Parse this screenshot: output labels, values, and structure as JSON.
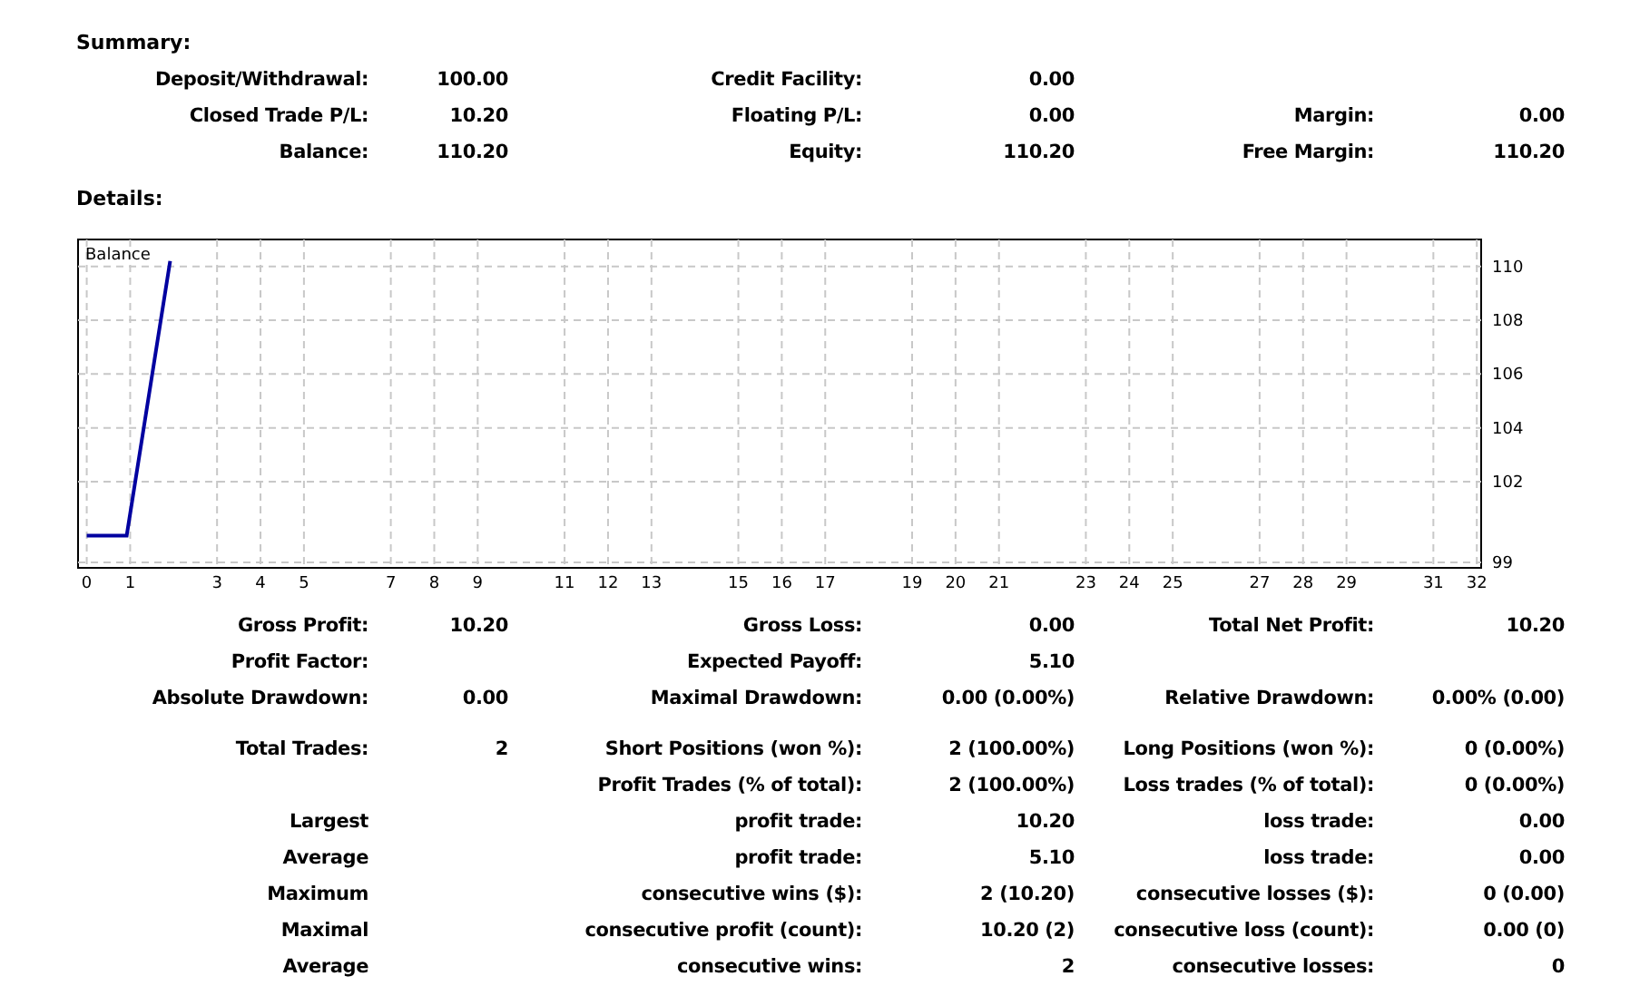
{
  "summary": {
    "title": "Summary:",
    "rows": [
      {
        "left": {
          "label": "Deposit/Withdrawal:",
          "value": "100.00"
        },
        "middle": {
          "label": "Credit Facility:",
          "value": "0.00"
        }
      },
      {
        "left": {
          "label": "Closed Trade P/L:",
          "value": "10.20"
        },
        "middle": {
          "label": "Floating P/L:",
          "value": "0.00"
        },
        "right": {
          "label": "Margin:",
          "value": "0.00"
        }
      },
      {
        "left": {
          "label": "Balance:",
          "value": "110.20"
        },
        "middle": {
          "label": "Equity:",
          "value": "110.20"
        },
        "right": {
          "label": "Free Margin:",
          "value": "110.20"
        }
      }
    ]
  },
  "details": {
    "title": "Details:",
    "chart_data": {
      "type": "line",
      "grid": true,
      "x": [
        0,
        0.92,
        1.92
      ],
      "xlim": [
        -0.2,
        32.1
      ],
      "ylim": [
        98.8,
        111
      ],
      "xticks": [
        0,
        1,
        3,
        4,
        5,
        7,
        8,
        9,
        11,
        12,
        13,
        15,
        16,
        17,
        19,
        20,
        21,
        23,
        24,
        25,
        27,
        28,
        29,
        31,
        32
      ],
      "yticks": [
        99,
        102,
        104,
        106,
        108,
        110
      ],
      "series": [
        {
          "name": "Balance",
          "color": "#0000a0",
          "values": [
            100,
            100,
            110.2
          ]
        }
      ]
    }
  },
  "stat_groups": [
    {
      "rows": [
        {
          "left": {
            "label": "Gross Profit:",
            "value": "10.20"
          },
          "middle": {
            "label": "Gross Loss:",
            "value": "0.00"
          },
          "right": {
            "label": "Total Net Profit:",
            "value": "10.20"
          }
        },
        {
          "left": {
            "label": "Profit Factor:"
          },
          "middle": {
            "label": "Expected Payoff:",
            "value": "5.10"
          }
        },
        {
          "left": {
            "label": "Absolute Drawdown:",
            "value": "0.00"
          },
          "middle": {
            "label": "Maximal Drawdown:",
            "value": "0.00 (0.00%)"
          },
          "right": {
            "label": "Relative Drawdown:",
            "value": "0.00% (0.00)"
          }
        }
      ]
    },
    {
      "rows": [
        {
          "left": {
            "label": "Total Trades:",
            "value": "2"
          },
          "middle": {
            "label": "Short Positions (won %):",
            "value": "2 (100.00%)"
          },
          "right": {
            "label": "Long Positions (won %):",
            "value": "0 (0.00%)"
          }
        },
        {
          "middle": {
            "label": "Profit Trades (% of total):",
            "value": "2 (100.00%)"
          },
          "right": {
            "label": "Loss trades (% of total):",
            "value": "0 (0.00%)"
          }
        },
        {
          "left": {
            "label": "Largest"
          },
          "middle": {
            "label": "profit trade:",
            "value": "10.20"
          },
          "right": {
            "label": "loss trade:",
            "value": "0.00"
          }
        },
        {
          "left": {
            "label": "Average"
          },
          "middle": {
            "label": "profit trade:",
            "value": "5.10"
          },
          "right": {
            "label": "loss trade:",
            "value": "0.00"
          }
        },
        {
          "left": {
            "label": "Maximum"
          },
          "middle": {
            "label": "consecutive wins ($):",
            "value": "2 (10.20)"
          },
          "right": {
            "label": "consecutive losses ($):",
            "value": "0 (0.00)"
          }
        },
        {
          "left": {
            "label": "Maximal"
          },
          "middle": {
            "label": "consecutive profit (count):",
            "value": "10.20 (2)"
          },
          "right": {
            "label": "consecutive loss (count):",
            "value": "0.00 (0)"
          }
        },
        {
          "left": {
            "label": "Average"
          },
          "middle": {
            "label": "consecutive wins:",
            "value": "2"
          },
          "right": {
            "label": "consecutive losses:",
            "value": "0"
          }
        }
      ]
    }
  ]
}
